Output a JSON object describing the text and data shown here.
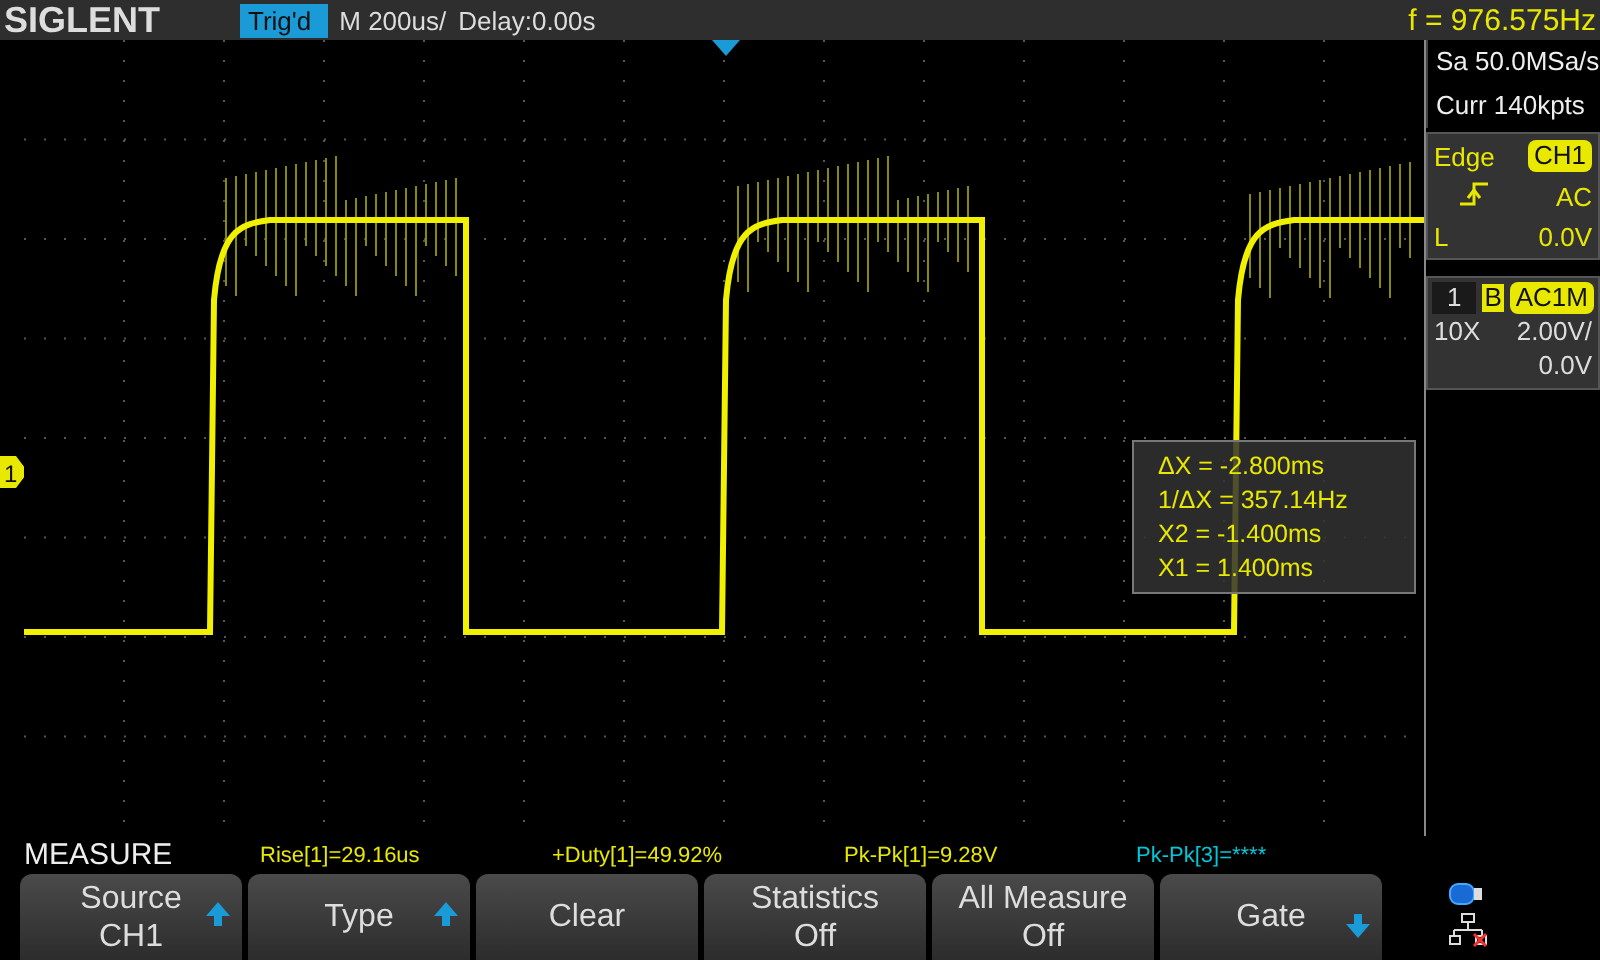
{
  "header": {
    "brand": "SIGLENT",
    "trigger_status": "Trig'd",
    "timebase": "M 200us/",
    "delay": "Delay:0.00s",
    "frequency": "f = 976.575Hz"
  },
  "acquisition": {
    "sample_rate": "Sa 50.0MSa/s",
    "memory_depth": "Curr 140kpts"
  },
  "trigger": {
    "type": "Edge",
    "source": "CH1",
    "coupling": "AC",
    "level_label": "L",
    "level_value": "0.0V"
  },
  "channel": {
    "number": "1",
    "bandwidth_limit": "B",
    "coupling": "AC1M",
    "probe": "10X",
    "scale": "2.00V/",
    "offset": "0.0V"
  },
  "waveform": {
    "marker": "1"
  },
  "cursor_readout": [
    "ΔX = -2.800ms",
    "1/ΔX = 357.14Hz",
    "X2 = -1.400ms",
    "X1 = 1.400ms"
  ],
  "measure": {
    "title": "MEASURE",
    "items": [
      {
        "text": "Rise[1]=29.16us",
        "color": "#e8e800"
      },
      {
        "text": "+Duty[1]=49.92%",
        "color": "#e8e800"
      },
      {
        "text": "Pk-Pk[1]=9.28V",
        "color": "#e8e800"
      },
      {
        "text": "Pk-Pk[3]=****",
        "color": "#00c8d8"
      }
    ]
  },
  "softkeys": [
    {
      "label": "Source",
      "value": "CH1",
      "kind": "up"
    },
    {
      "label": "Type",
      "kind": "up"
    },
    {
      "label": "Clear",
      "kind": "plain"
    },
    {
      "label": "Statistics",
      "value": "Off",
      "kind": "plain"
    },
    {
      "label": "All Measure",
      "value": "Off",
      "kind": "plain"
    },
    {
      "label": "Gate",
      "kind": "down"
    }
  ]
}
